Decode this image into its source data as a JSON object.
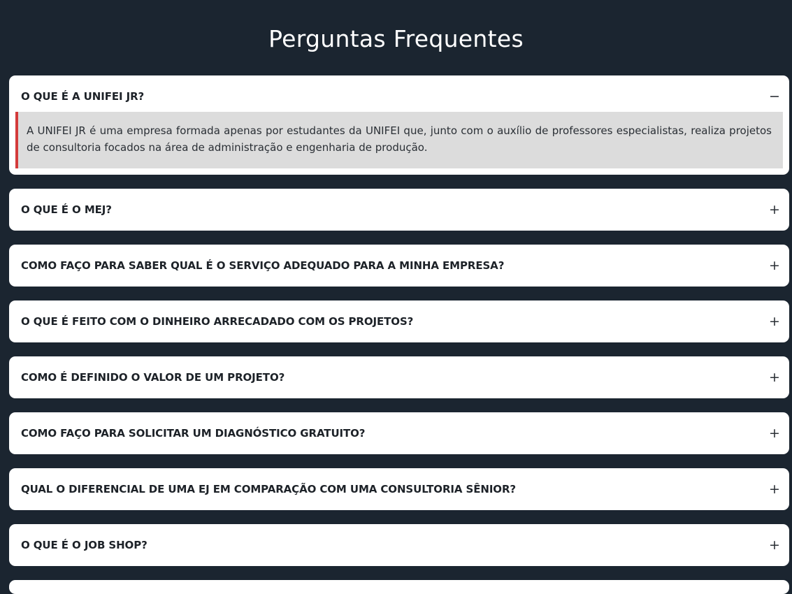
{
  "page": {
    "title": "Perguntas Frequentes"
  },
  "faq": [
    {
      "question": "O QUE É A UNIFEI JR?",
      "toggle": "−",
      "open": true,
      "answer": "A UNIFEI JR é uma empresa formada apenas por estudantes da UNIFEI que, junto com o auxílio de professores especialistas, realiza projetos de consultoria focados na área de administração e engenharia de produção."
    },
    {
      "question": "O QUE É O MEJ?",
      "toggle": "+"
    },
    {
      "question": "COMO FAÇO PARA SABER QUAL É O SERVIÇO ADEQUADO PARA A MINHA EMPRESA?",
      "toggle": "+"
    },
    {
      "question": "O QUE É FEITO COM O DINHEIRO ARRECADADO COM OS PROJETOS?",
      "toggle": "+"
    },
    {
      "question": "COMO É DEFINIDO O VALOR DE UM PROJETO?",
      "toggle": "+"
    },
    {
      "question": "COMO FAÇO PARA SOLICITAR UM DIAGNÓSTICO GRATUITO?",
      "toggle": "+"
    },
    {
      "question": "QUAL O DIFERENCIAL DE UMA EJ EM COMPARAÇÃO COM UMA CONSULTORIA SÊNIOR?",
      "toggle": "+"
    },
    {
      "question": "O QUE É O JOB SHOP?",
      "toggle": "+"
    }
  ],
  "colors": {
    "background": "#1b2530",
    "card": "#ffffff",
    "answer_bg": "#dcdcdc",
    "accent": "#d33a3a"
  }
}
